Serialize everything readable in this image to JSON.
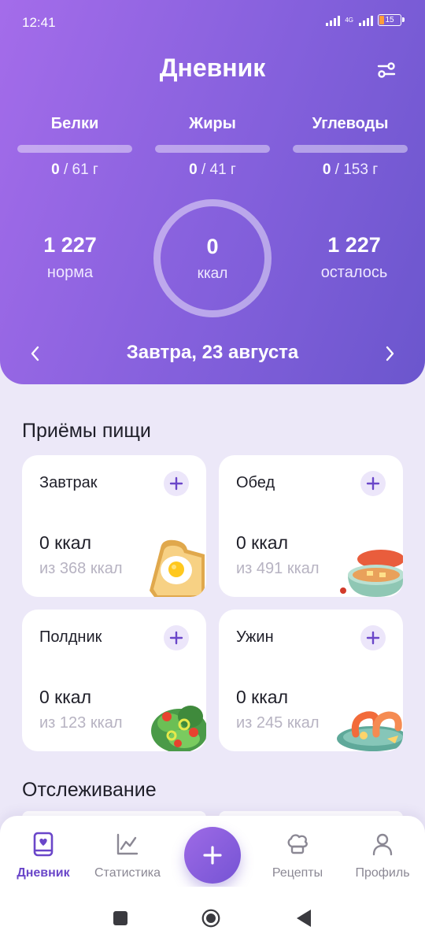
{
  "status_bar": {
    "time": "12:41",
    "network": "4G",
    "battery": "15"
  },
  "header": {
    "title": "Дневник",
    "filter_icon": "sliders-icon"
  },
  "macros": [
    {
      "name": "Белки",
      "value": "0",
      "target": " / 61 г",
      "progress": 0
    },
    {
      "name": "Жиры",
      "value": "0",
      "target": " / 41 г",
      "progress": 0
    },
    {
      "name": "Углеводы",
      "value": "0",
      "target": " / 153 г",
      "progress": 0
    }
  ],
  "summary": {
    "norm_value": "1 227",
    "norm_label": "норма",
    "eaten_value": "0",
    "eaten_label": "ккал",
    "left_value": "1 227",
    "left_label": "осталось"
  },
  "date": {
    "label": "Завтра,  23 августа"
  },
  "meals_section": {
    "title": "Приёмы пищи",
    "items": [
      {
        "name": "Завтрак",
        "kcal": "0 ккал",
        "of": "из 368 ккал",
        "image": "toast-egg-icon"
      },
      {
        "name": "Обед",
        "kcal": "0 ккал",
        "of": "из 491 ккал",
        "image": "soup-pot-icon"
      },
      {
        "name": "Полдник",
        "kcal": "0 ккал",
        "of": "из 123 ккал",
        "image": "salad-icon"
      },
      {
        "name": "Ужин",
        "kcal": "0 ккал",
        "of": "из 245 ккал",
        "image": "shrimp-plate-icon"
      }
    ]
  },
  "tracking_section": {
    "title": "Отслеживание"
  },
  "bottom_nav": {
    "items": [
      {
        "label": "Дневник",
        "icon": "diary-book-icon",
        "active": true
      },
      {
        "label": "Статистика",
        "icon": "chart-icon",
        "active": false
      },
      {
        "label": "Рецепты",
        "icon": "chef-hat-icon",
        "active": false
      },
      {
        "label": "Профиль",
        "icon": "user-icon",
        "active": false
      }
    ],
    "fab_icon": "plus-icon"
  },
  "colors": {
    "accent": "#6a46c9",
    "header_start": "#a46cea",
    "header_end": "#6b56cd",
    "background": "#ece8f8"
  }
}
